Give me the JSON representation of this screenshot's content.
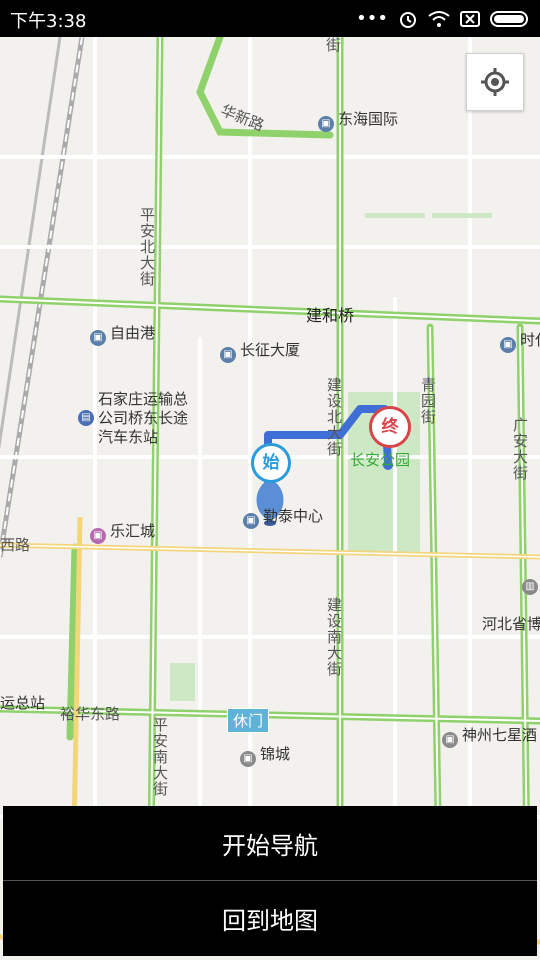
{
  "status_bar": {
    "time": "下午3:38",
    "icons": [
      "more-dots-icon",
      "alarm-icon",
      "wifi-icon",
      "no-sim-icon",
      "battery-icon"
    ]
  },
  "map": {
    "roads": {
      "huaxin": "华新路",
      "pingan_north": "平安北大街",
      "jianhe": "建和桥",
      "jianshe_north": "建设北大街",
      "qingyuan": "青园街",
      "guangan": "广安大街",
      "jianshe_south": "建设南大街",
      "pingan_south": "平安南大街",
      "yuhua_east": "裕华东路",
      "top_street": "街",
      "west_road": "西路"
    },
    "pois": {
      "donghai": "东海国际",
      "ziyougang": "自由港",
      "changzheng": "长征大厦",
      "shidai": "时代",
      "bus_station": "石家庄运输总公司桥东长途汽车东站",
      "changan_park": "长安公园",
      "taitai": "勒泰中心",
      "lehui": "乐汇城",
      "hebei": "河北省博",
      "jincheng": "锦城",
      "shenzhou": "神州七星酒",
      "south_station": "运总站"
    },
    "metro": "休门",
    "start_marker": "始",
    "end_marker": "终",
    "colors": {
      "road_green": "#8fd16a",
      "road_yellow": "#f3d57a",
      "route_blue": "#3f6fd6",
      "park_green": "#cde8c4"
    }
  },
  "controls": {
    "locate_icon": "locate-target-icon",
    "start_nav": "开始导航",
    "back_to_map": "回到地图"
  }
}
